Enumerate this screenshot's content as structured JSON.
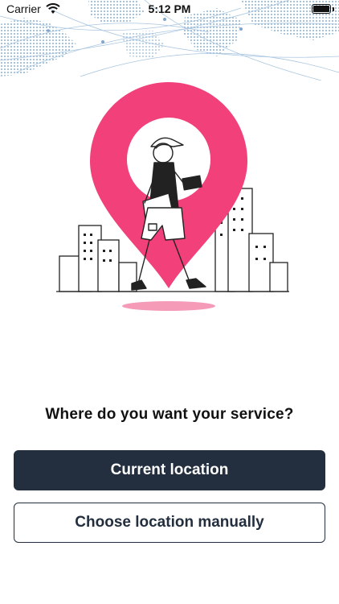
{
  "status_bar": {
    "carrier": "Carrier",
    "time": "5:12 PM",
    "icons": [
      "wifi-icon",
      "battery-icon"
    ]
  },
  "main": {
    "question": "Where do you want your service?",
    "primary_button_label": "Current location",
    "secondary_button_label": "Choose location manually"
  },
  "colors": {
    "brand_dark": "#232f3e",
    "pin_pink": "#f2407a",
    "map_blue": "#8fb4d6",
    "background": "#ffffff"
  }
}
